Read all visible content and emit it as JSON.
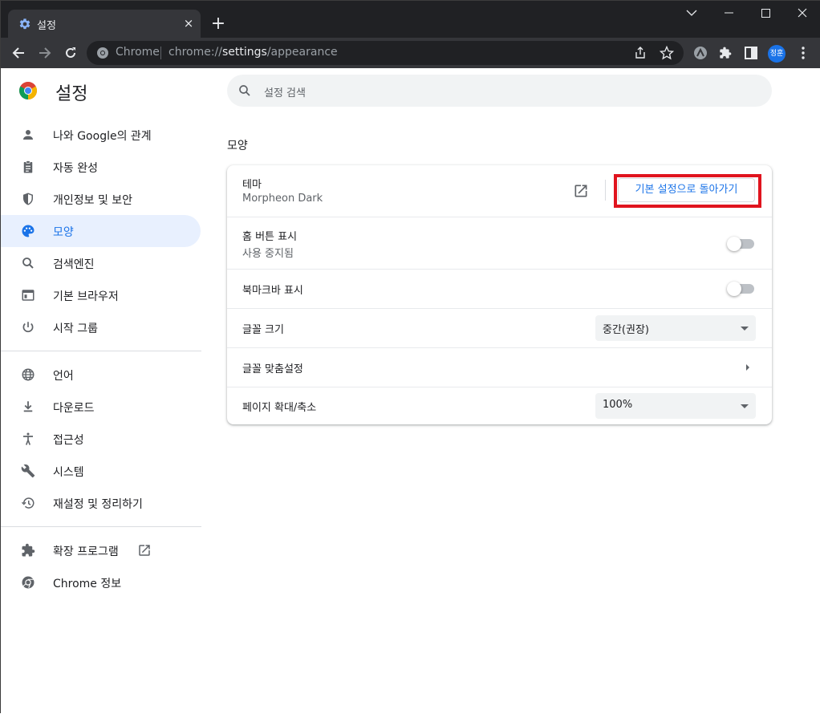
{
  "tab": {
    "title": "설정",
    "close": "×"
  },
  "omnibox": {
    "chip": "Chrome",
    "url_prefix": "chrome://",
    "url_host": "settings",
    "url_path": "/appearance"
  },
  "profile": {
    "initials": "정훈"
  },
  "app": {
    "title": "설정"
  },
  "search": {
    "placeholder": "설정 검색"
  },
  "sidebar": {
    "items": [
      {
        "label": "나와 Google의 관계",
        "icon": "person-icon"
      },
      {
        "label": "자동 완성",
        "icon": "clipboard-icon"
      },
      {
        "label": "개인정보 및 보안",
        "icon": "shield-icon"
      },
      {
        "label": "모양",
        "icon": "palette-icon",
        "active": true
      },
      {
        "label": "검색엔진",
        "icon": "search-icon"
      },
      {
        "label": "기본 브라우저",
        "icon": "browser-icon"
      },
      {
        "label": "시작 그룹",
        "icon": "power-icon"
      },
      {
        "label": "언어",
        "icon": "globe-icon"
      },
      {
        "label": "다운로드",
        "icon": "download-icon"
      },
      {
        "label": "접근성",
        "icon": "accessibility-icon"
      },
      {
        "label": "시스템",
        "icon": "wrench-icon"
      },
      {
        "label": "재설정 및 정리하기",
        "icon": "history-icon"
      },
      {
        "label": "확장 프로그램",
        "icon": "puzzle-icon"
      },
      {
        "label": "Chrome 정보",
        "icon": "chrome-icon"
      }
    ]
  },
  "section": {
    "title": "모양"
  },
  "appearance": {
    "theme_label": "테마",
    "theme_value": "Morpheon Dark",
    "reset_button": "기본 설정으로 돌아가기",
    "home_button_label": "홈 버튼 표시",
    "home_button_sub": "사용 중지됨",
    "bookmarks_bar_label": "북마크바 표시",
    "font_size_label": "글꼴 크기",
    "font_size_value": "중간(권장)",
    "customize_fonts_label": "글꼴 맞춤설정",
    "page_zoom_label": "페이지 확대/축소",
    "page_zoom_value": "100%"
  },
  "colors": {
    "accent": "#1a73e8",
    "highlight": "#e0141e",
    "active_bg": "#e8f0fe"
  }
}
